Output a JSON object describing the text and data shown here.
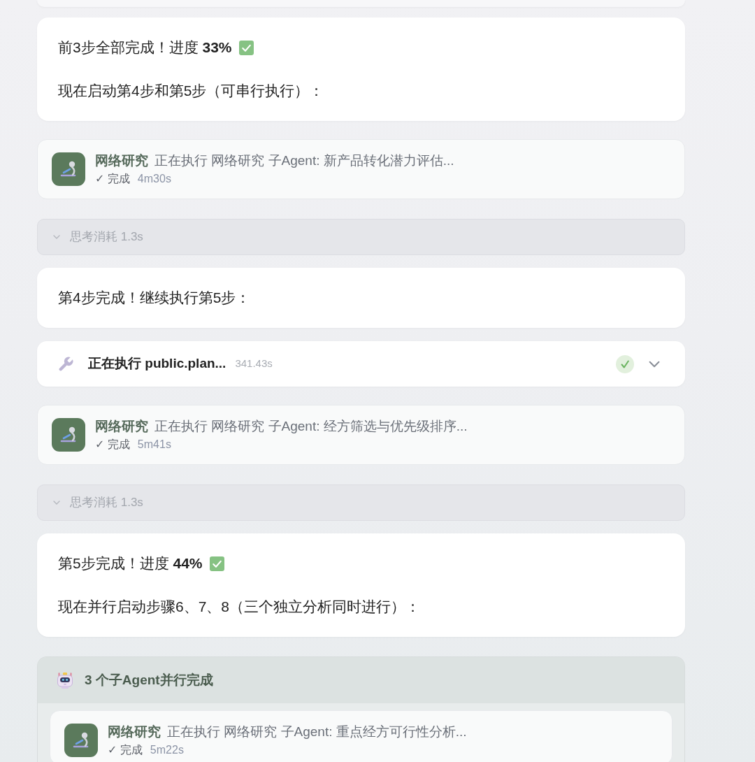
{
  "stream": [
    {
      "kind": "message",
      "paragraphs": [
        {
          "text": "前3步全部完成！进度 **33%**",
          "check_mark": true
        },
        {
          "text": "现在启动第4步和第5步（可串行执行）：",
          "check_mark": false
        }
      ]
    },
    {
      "kind": "agent",
      "name": "网络研究",
      "task": "正在执行 网络研究 子Agent: 新产品转化潜力评估...",
      "status": "✓ 完成",
      "duration": "4m30s"
    },
    {
      "kind": "thinking",
      "label": "思考消耗 1.3s",
      "expanded": false
    },
    {
      "kind": "message",
      "paragraphs": [
        {
          "text": "第4步完成！继续执行第5步：",
          "check_mark": false
        }
      ]
    },
    {
      "kind": "tool",
      "label": "正在执行 public.plan...",
      "duration": "341.43s",
      "done": true,
      "expanded": false
    },
    {
      "kind": "agent",
      "name": "网络研究",
      "task": "正在执行 网络研究 子Agent: 经方筛选与优先级排序...",
      "status": "✓ 完成",
      "duration": "5m41s"
    },
    {
      "kind": "thinking",
      "label": "思考消耗 1.3s",
      "expanded": false
    },
    {
      "kind": "message",
      "paragraphs": [
        {
          "text": "第5步完成！进度 **44%**",
          "check_mark": true
        },
        {
          "text": "现在并行启动步骤6、7、8（三个独立分析同时进行）：",
          "check_mark": false
        }
      ]
    },
    {
      "kind": "group",
      "title": "3 个子Agent并行完成",
      "agents": [
        {
          "name": "网络研究",
          "task": "正在执行 网络研究 子Agent: 重点经方可行性分析...",
          "status": "✓ 完成",
          "duration": "5m22s"
        }
      ]
    }
  ]
}
